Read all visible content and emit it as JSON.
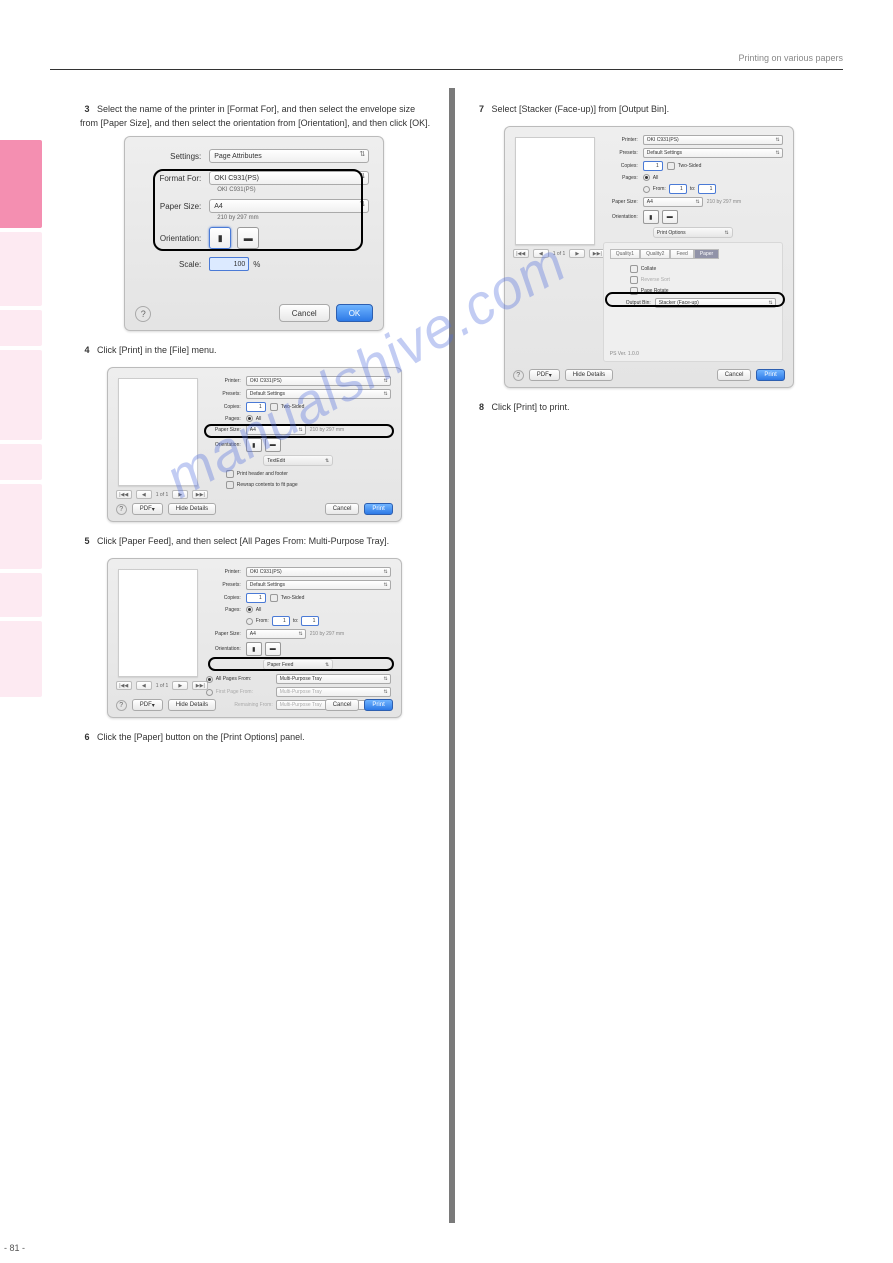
{
  "header": {
    "breadcrumb": "Printing on various papers"
  },
  "pageNumber": "- 81 -",
  "watermark": "manualshive.com",
  "sidetabs": {
    "active_index": 0
  },
  "steps": {
    "s3": "Select the name of the printer in [Format For], and then select the envelope size from [Paper Size], and then select the orientation from [Orientation], and then click [OK].",
    "s4": "Click [Print] in the [File] menu.",
    "s5": "Click [Paper Feed], and then select [All Pages From: Multi-Purpose Tray].",
    "s6": "Click the [Paper] button on the [Print Options] panel.",
    "s7": "Select [Stacker (Face-up)] from [Output Bin].",
    "s8": "Click [Print] to print."
  },
  "dlg1": {
    "settings_label": "Settings:",
    "settings_value": "Page Attributes",
    "format_label": "Format For:",
    "format_value": "OKI C931(PS)",
    "format_sub": "OKI C931(PS)",
    "paper_label": "Paper Size:",
    "paper_value": "A4",
    "paper_sub": "210 by 297 mm",
    "orient_label": "Orientation:",
    "scale_label": "Scale:",
    "scale_value": "100",
    "scale_pct": "%",
    "cancel": "Cancel",
    "ok": "OK"
  },
  "printDlg": {
    "printer_label": "Printer:",
    "printer_value": "OKI C931(PS)",
    "presets_label": "Presets:",
    "presets_value": "Default Settings",
    "copies_label": "Copies:",
    "copies_value": "1",
    "twosided": "Two-Sided",
    "pages_label": "Pages:",
    "pages_all": "All",
    "pages_from": "From:",
    "pages_from_v": "1",
    "pages_to": "to:",
    "pages_to_v": "1",
    "papersize_label": "Paper Size:",
    "papersize_value": "A4",
    "papersize_dim": "210 by 297 mm",
    "orientation_label": "Orientation:",
    "panel_textedit": "TextEdit",
    "te_opt1": "Print header and footer",
    "te_opt2": "Rewrap contents to fit page",
    "panel_paperfeed": "Paper Feed",
    "pf_all": "All Pages From:",
    "pf_first": "First Page From:",
    "pf_remaining": "Remaining From:",
    "pf_tray": "Multi-Purpose Tray",
    "panel_printoptions": "Print Options",
    "po_tab1": "Quality1",
    "po_tab2": "Quality2",
    "po_tab3": "Feed",
    "po_tab4": "Paper",
    "po_collate": "Collate",
    "po_reverse": "Reverse Sort",
    "po_rotate": "Page Rotate",
    "po_output_label": "Output Bin:",
    "po_output_value": "Stacker (Face-up)",
    "po_ver": "PS Ver. 1.0.0",
    "preview_nav": "1 of 1",
    "pdf": "PDF",
    "hide": "Hide Details",
    "cancel": "Cancel",
    "print": "Print"
  }
}
